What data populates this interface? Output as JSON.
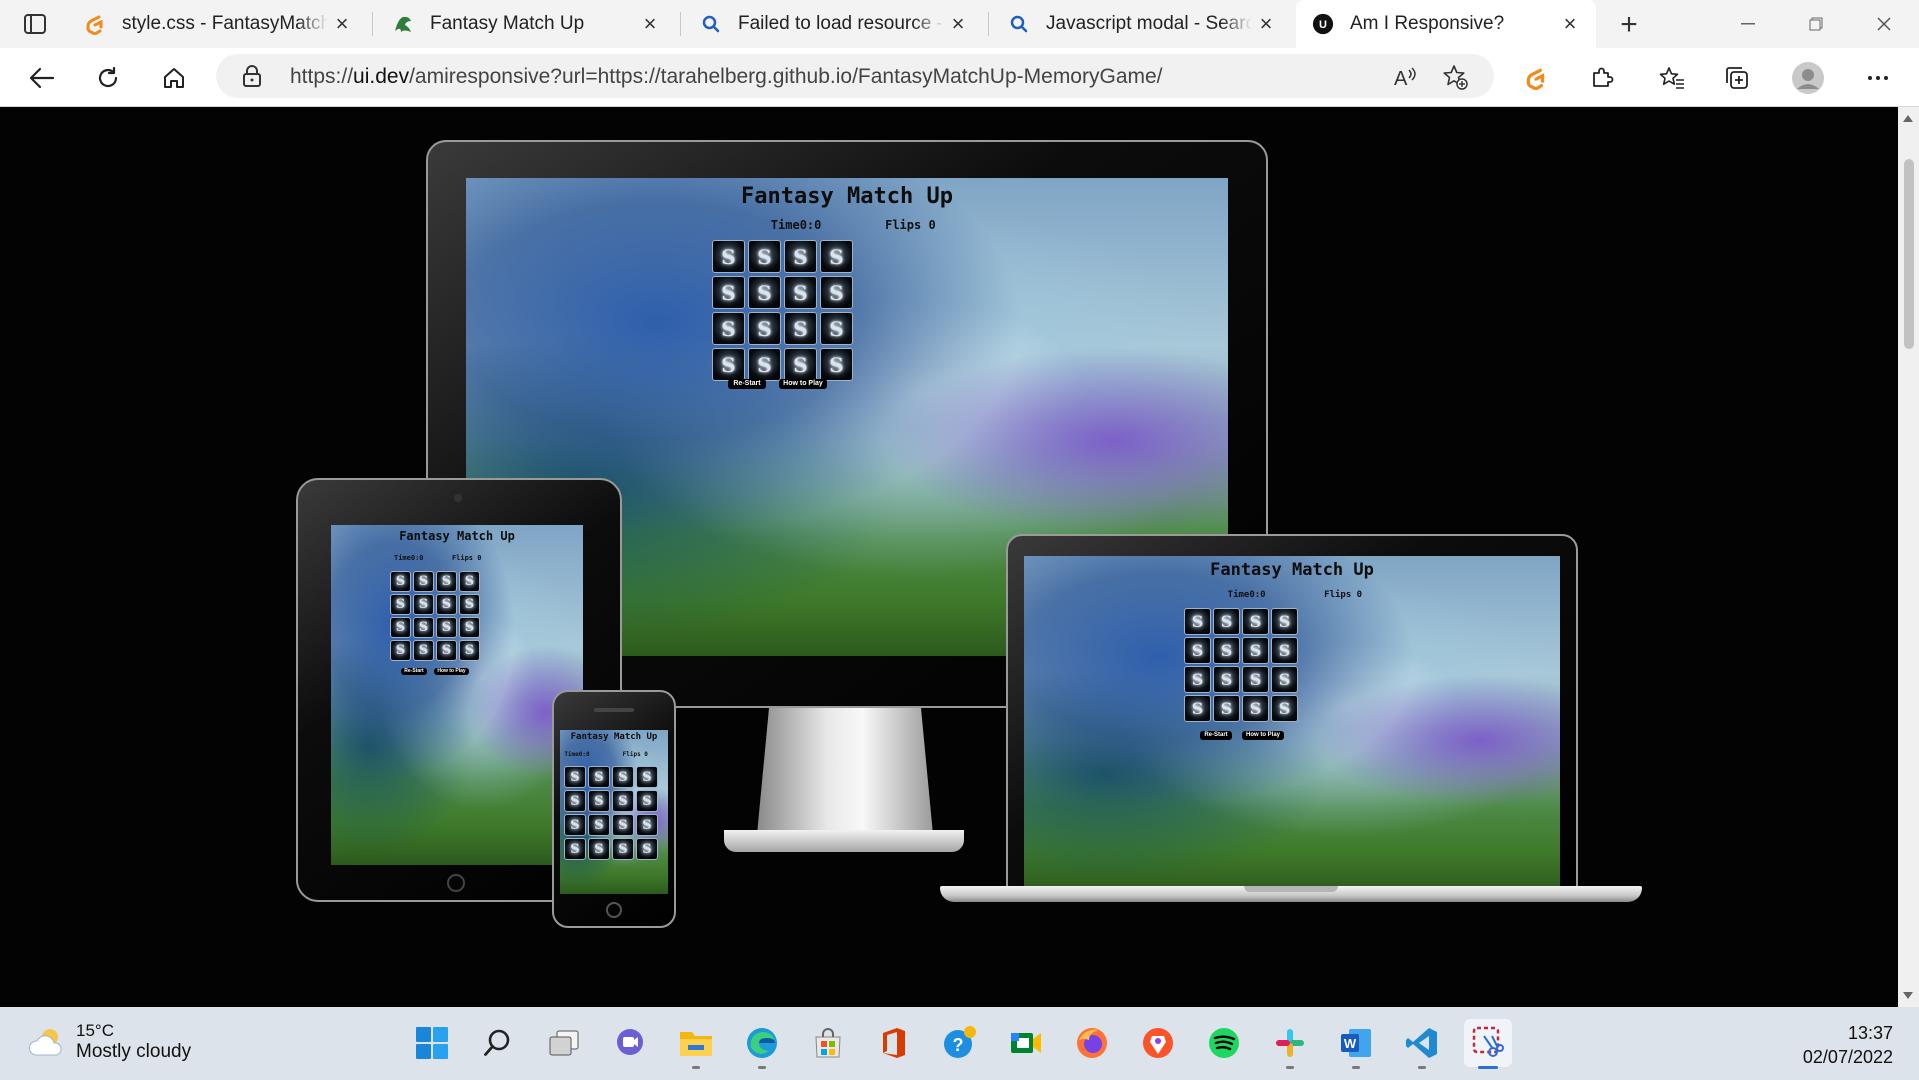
{
  "browser": {
    "tabs": [
      {
        "title": "style.css - FantasyMatchUp",
        "icon": "gitpod-icon",
        "active": false
      },
      {
        "title": "Fantasy Match Up",
        "icon": "dragon-favicon",
        "active": false
      },
      {
        "title": "Failed to load resource - Search",
        "icon": "search-icon",
        "active": false
      },
      {
        "title": "Javascript modal - Search",
        "icon": "search-icon",
        "active": false
      },
      {
        "title": "Am I Responsive?",
        "icon": "ui-dev-icon",
        "active": true
      }
    ],
    "url_prefix": "https://",
    "url_domain": "ui.dev",
    "url_rest": "/amiresponsive?url=https://tarahelberg.github.io/FantasyMatchUp-MemoryGame/",
    "accent": "#f08c1e"
  },
  "game": {
    "title": "Fantasy Match Up",
    "time_label": "Time0:0",
    "flips_label": "Flips 0",
    "restart_label": "Re-Start",
    "howto_label": "How to Play",
    "card_glyph": "S",
    "card_count": 16
  },
  "taskbar": {
    "weather_temp": "15°C",
    "weather_desc": "Mostly cloudy",
    "time": "13:37",
    "date": "02/07/2022",
    "apps": [
      "start",
      "search",
      "task-view",
      "teams-chat",
      "file-explorer",
      "edge",
      "microsoft-store",
      "office",
      "help-tips",
      "meet",
      "firefox",
      "brave",
      "spotify",
      "slack",
      "word",
      "vscode",
      "snipping-tool"
    ]
  }
}
